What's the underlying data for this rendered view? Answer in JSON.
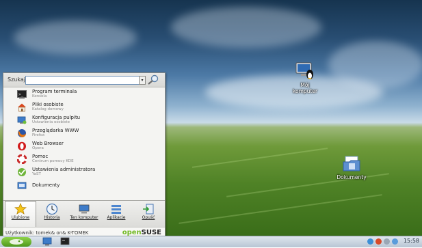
{
  "desktop": {
    "icons": [
      {
        "label_line1": "Mój",
        "label_line2": "komputer"
      },
      {
        "label": "Dokumenty"
      }
    ]
  },
  "menu": {
    "search": {
      "label": "Szukaj:",
      "value": ""
    },
    "items": [
      {
        "title": "Program terminala",
        "subtitle": "Konsola",
        "icon": "terminal-icon"
      },
      {
        "title": "Pliki osobiste",
        "subtitle": "Katalog domowy",
        "icon": "home-folder-icon"
      },
      {
        "title": "Konfiguracja pulpitu",
        "subtitle": "Ustawienia osobiste",
        "icon": "desktop-settings-icon"
      },
      {
        "title": "Przeglądarka WWW",
        "subtitle": "Firefox",
        "icon": "firefox-icon"
      },
      {
        "title": "Web Browser",
        "subtitle": "Opera",
        "icon": "opera-icon"
      },
      {
        "title": "Pomoc",
        "subtitle": "Centrum pomocy KDE",
        "icon": "help-lifebuoy-icon"
      },
      {
        "title": "Ustawienia administratora",
        "subtitle": "YaST",
        "icon": "yast-icon"
      },
      {
        "title": "Dokumenty",
        "subtitle": "",
        "icon": "documents-folder-icon"
      }
    ],
    "tabs": [
      {
        "label": "Ulubione",
        "icon": "star-icon",
        "active": true
      },
      {
        "label": "Historia",
        "icon": "clock-icon",
        "active": false
      },
      {
        "label": "Ten komputer",
        "icon": "computer-icon",
        "active": false
      },
      {
        "label": "Aplikacje",
        "icon": "list-icon",
        "active": false
      },
      {
        "label": "Opuść",
        "icon": "logout-icon",
        "active": false
      }
    ],
    "footer": {
      "user": "Użytkownik: tomek& on& K-TOMEK",
      "brand_part1": "open",
      "brand_part2": "SUSE"
    }
  },
  "taskbar": {
    "clock": "15:58"
  },
  "colors": {
    "suse_green": "#73ba25",
    "accent_blue": "#6d8fb6"
  }
}
